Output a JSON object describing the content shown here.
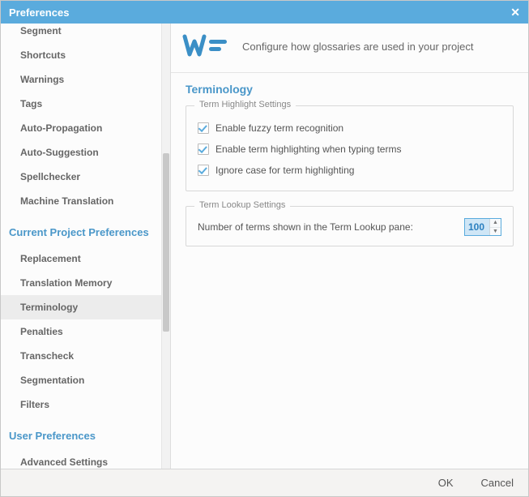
{
  "window": {
    "title": "Preferences"
  },
  "sidebar": {
    "groups": [
      {
        "header": "",
        "items": [
          {
            "label": "Segment",
            "cut": true
          },
          {
            "label": "Shortcuts"
          },
          {
            "label": "Warnings"
          },
          {
            "label": "Tags"
          },
          {
            "label": "Auto-Propagation"
          },
          {
            "label": "Auto-Suggestion"
          },
          {
            "label": "Spellchecker"
          },
          {
            "label": "Machine Translation"
          }
        ]
      },
      {
        "header": "Current Project Preferences",
        "items": [
          {
            "label": "Replacement"
          },
          {
            "label": "Translation Memory"
          },
          {
            "label": "Terminology",
            "selected": true
          },
          {
            "label": "Penalties"
          },
          {
            "label": "Transcheck"
          },
          {
            "label": "Segmentation"
          },
          {
            "label": "Filters"
          }
        ]
      },
      {
        "header": "User Preferences",
        "items": [
          {
            "label": "Advanced Settings"
          }
        ]
      }
    ]
  },
  "header": {
    "description": "Configure how glossaries are used in your project"
  },
  "page": {
    "title": "Terminology",
    "highlight": {
      "legend": "Term Highlight Settings",
      "fuzzy": "Enable fuzzy term recognition",
      "typing": "Enable term highlighting when typing terms",
      "ignorecase": "Ignore case for term highlighting"
    },
    "lookup": {
      "legend": "Term Lookup Settings",
      "label": "Number of terms shown in the Term Lookup pane:",
      "value": "100"
    }
  },
  "footer": {
    "ok": "OK",
    "cancel": "Cancel"
  }
}
